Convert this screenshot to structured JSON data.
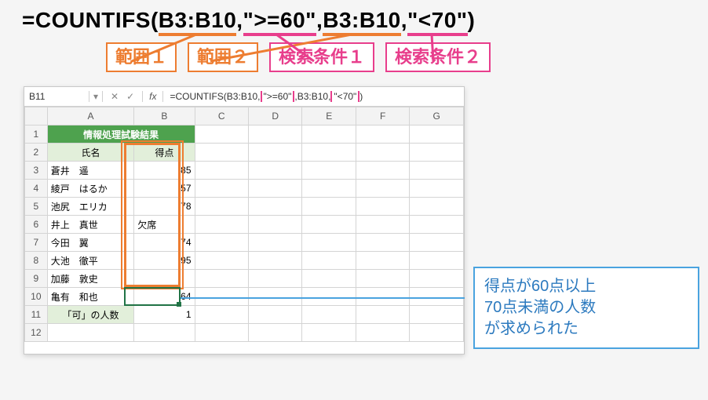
{
  "formula_display": {
    "prefix": "=COUNTIFS(",
    "p1": "B3:B10",
    "sep1": ",",
    "p2": "\">=60\"",
    "sep2": ",",
    "p3": "B3:B10",
    "sep3": ",",
    "p4": "\"<70\"",
    "suffix": ")"
  },
  "labels": {
    "range1": "範囲１",
    "range2": "範囲２",
    "crit1": "検索条件１",
    "crit2": "検索条件２"
  },
  "namebox": "B11",
  "fx_label": "fx",
  "formula_bar": {
    "prefix": "=COUNTIFS(B3:B10,",
    "crit1": "\">=60\"",
    "mid": ",B3:B10,",
    "crit2": "\"<70\"",
    "suffix": ")"
  },
  "columns": [
    "A",
    "B",
    "C",
    "D",
    "E",
    "F",
    "G"
  ],
  "row_numbers": [
    "1",
    "2",
    "3",
    "4",
    "5",
    "6",
    "7",
    "8",
    "9",
    "10",
    "11",
    "12"
  ],
  "title_merged": "情報処理試験結果",
  "headers": {
    "name": "氏名",
    "score": "得点"
  },
  "rows": [
    {
      "name": "蒼井　遥",
      "score": "85"
    },
    {
      "name": "綾戸　はるか",
      "score": "57"
    },
    {
      "name": "池尻　エリカ",
      "score": "78"
    },
    {
      "name": "井上　真世",
      "score": "欠席"
    },
    {
      "name": "今田　翼",
      "score": "74"
    },
    {
      "name": "大池　徹平",
      "score": "95"
    },
    {
      "name": "加藤　敦史",
      "score": ""
    },
    {
      "name": "亀有　和也",
      "score": "64"
    }
  ],
  "result_row": {
    "label": "「可」の人数",
    "value": "1"
  },
  "callout": {
    "l1": "得点が60点以上",
    "l2": "70点未満の人数",
    "l3": "が求められた"
  },
  "chart_data": {
    "type": "table",
    "title": "情報処理試験結果",
    "columns": [
      "氏名",
      "得点"
    ],
    "rows": [
      [
        "蒼井　遥",
        85
      ],
      [
        "綾戸　はるか",
        57
      ],
      [
        "池尻　エリカ",
        78
      ],
      [
        "井上　真世",
        "欠席"
      ],
      [
        "今田　翼",
        74
      ],
      [
        "大池　徹平",
        95
      ],
      [
        "加藤　敦史",
        null
      ],
      [
        "亀有　和也",
        64
      ]
    ],
    "summary": {
      "label": "「可」の人数",
      "value": 1,
      "criteria": "得点>=60 かつ 得点<70"
    }
  }
}
